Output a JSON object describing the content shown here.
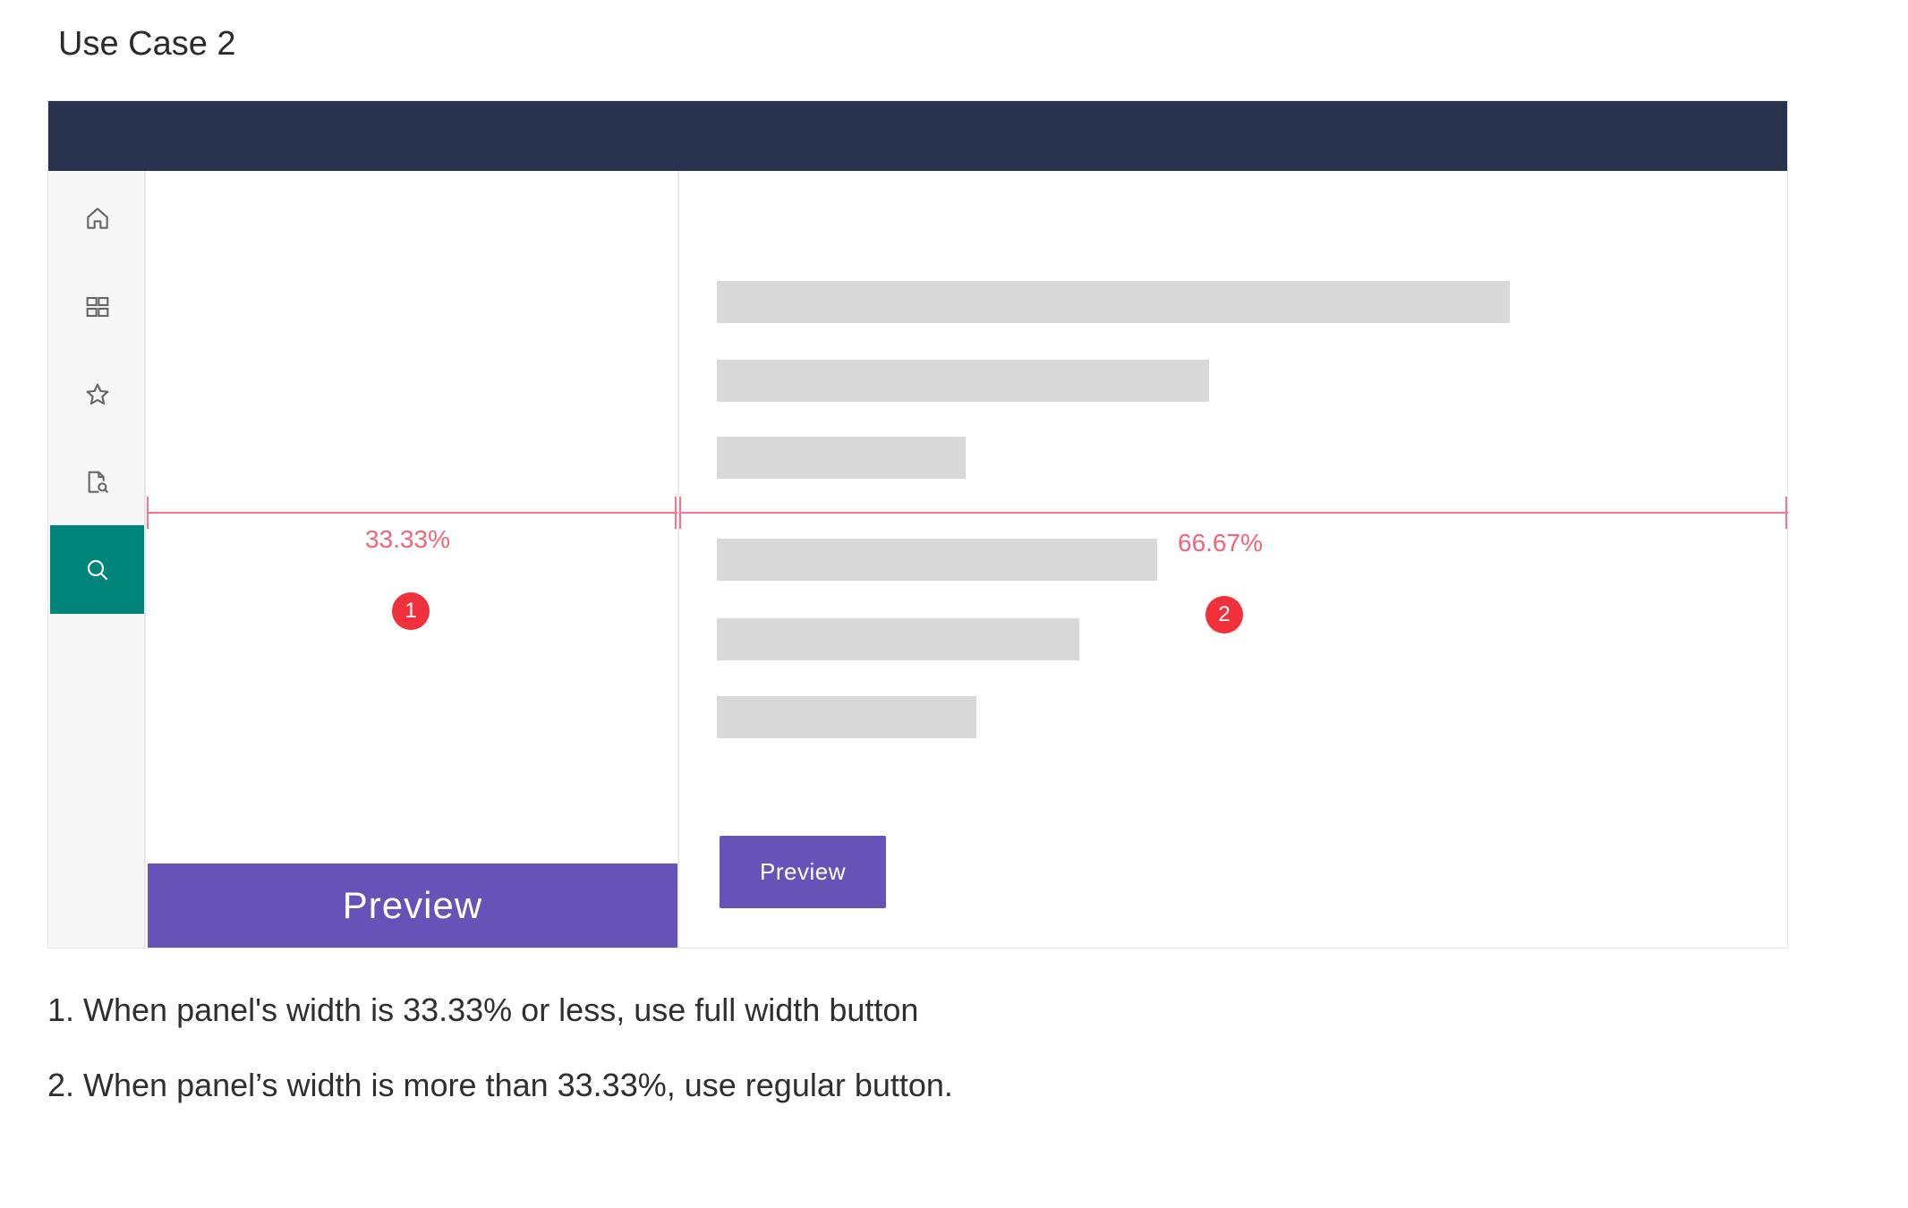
{
  "page": {
    "title": "Use Case 2"
  },
  "sidebar": {
    "items": [
      {
        "icon": "home-icon",
        "active": false
      },
      {
        "icon": "grid-icon",
        "active": false
      },
      {
        "icon": "star-icon",
        "active": false
      },
      {
        "icon": "document-search-icon",
        "active": false
      },
      {
        "icon": "search-icon",
        "active": true
      }
    ],
    "active_color": "#00857a"
  },
  "annotations": {
    "left_panel": {
      "width_label": "33.33%",
      "badge": "1"
    },
    "right_panel": {
      "width_label": "66.67%",
      "badge": "2"
    },
    "color": "#f26478"
  },
  "buttons": {
    "full_width_label": "Preview",
    "regular_label": "Preview",
    "color": "#6753b7"
  },
  "colors": {
    "topbar": "#29334d",
    "placeholder": "#d8d8d8"
  },
  "notes": [
    "1. When panel's width is 33.33% or less, use full width button",
    "2. When panel’s width is more than 33.33%, use regular button."
  ]
}
